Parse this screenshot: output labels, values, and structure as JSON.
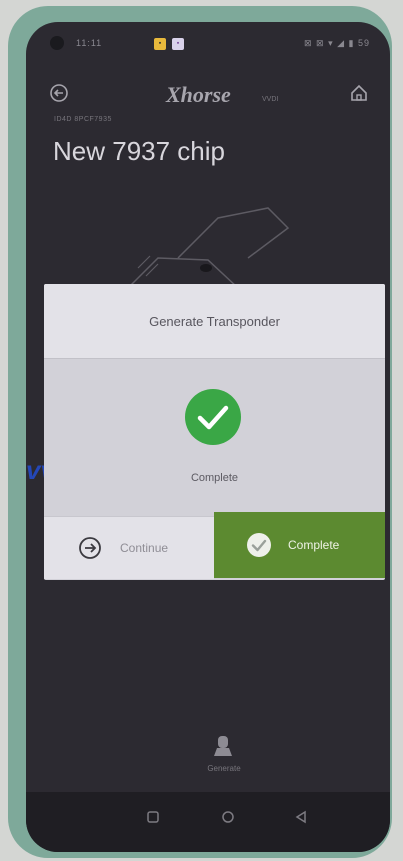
{
  "status_bar": {
    "time": "11:11",
    "right": "⊠ ⊠ ▾ ◢ ▮ 59"
  },
  "app": {
    "logo": "Xhorse",
    "logo_sub": "VVDI",
    "subtitle": "ID4D 8PCF7935",
    "title": "New 7937 chip"
  },
  "dialog": {
    "title": "Generate Transponder",
    "status": "Complete",
    "continue_label": "Continue",
    "complete_label": "Complete"
  },
  "watermark": "vvdi",
  "bottom_action": {
    "label": "Generate"
  },
  "colors": {
    "accent_green": "#5c8a30",
    "check_green": "#3aa746",
    "watermark_blue": "#2447b8"
  }
}
